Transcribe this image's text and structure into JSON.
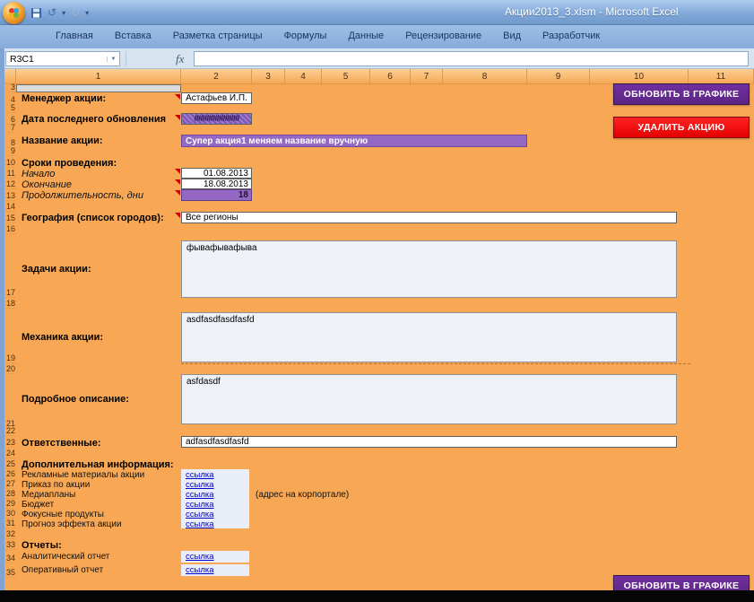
{
  "window": {
    "title": "Акции2013_3.xlsm - Microsoft Excel"
  },
  "quick_access": {
    "icons": [
      "office-button",
      "save-icon",
      "undo-icon",
      "redo-icon",
      "customize-icon"
    ]
  },
  "ribbon": {
    "tabs": [
      "Главная",
      "Вставка",
      "Разметка страницы",
      "Формулы",
      "Данные",
      "Рецензирование",
      "Вид",
      "Разработчик"
    ]
  },
  "formula_bar": {
    "name_box": "R3C1",
    "fx_label": "fx",
    "formula": ""
  },
  "grid": {
    "columns": [
      "1",
      "2",
      "3",
      "4",
      "5",
      "6",
      "7",
      "8",
      "9",
      "10",
      "11"
    ],
    "rows": [
      "3",
      "4",
      "5",
      "6",
      "7",
      "8",
      "9",
      "10",
      "11",
      "12",
      "13",
      "14",
      "15",
      "16",
      "17",
      "18",
      "19",
      "20",
      "21",
      "22",
      "23",
      "24",
      "25",
      "26",
      "27",
      "28",
      "29",
      "30",
      "31",
      "32",
      "33",
      "34",
      "35"
    ]
  },
  "form": {
    "manager_label": "Менеджер акции:",
    "manager_value": "Астафьев И.П.",
    "updated_label": "Дата последнего обновления",
    "updated_value": "###########",
    "name_label": "Название акции:",
    "name_value": "Супер акция1 меняем название вручную",
    "dates_header": "Сроки проведения:",
    "start_label": "Начало",
    "start_value": "01.08.2013",
    "end_label": "Окончание",
    "end_value": "18.08.2013",
    "duration_label": "Продолжительность, дни",
    "duration_value": "18",
    "geography_label": "География (список городов):",
    "geography_value": "Все регионы",
    "tasks_label": "Задачи акции:",
    "tasks_value": "фывафывафыва",
    "mechanics_label": "Механика акции:",
    "mechanics_value": "asdfasdfasdfasfd",
    "description_label": "Подробное описание:",
    "description_value": "asfdasdf",
    "responsible_label": "Ответственные:",
    "responsible_value": "adfasdfasdfasfd",
    "additional_header": "Дополнительная информация:",
    "extra_links": [
      {
        "label": "Рекламные материалы акции",
        "link": "ссылка",
        "note": ""
      },
      {
        "label": "Приказ по акции",
        "link": "ссылка",
        "note": ""
      },
      {
        "label": "Медиапланы",
        "link": "ссылка",
        "note": "(адрес на корпортале)"
      },
      {
        "label": "Бюджет",
        "link": "ссылка",
        "note": ""
      },
      {
        "label": "Фокусные продукты",
        "link": "ссылка",
        "note": ""
      },
      {
        "label": "Прогноз эффекта акции",
        "link": "ссылка",
        "note": ""
      }
    ],
    "reports_header": "Отчеты:",
    "report_links": [
      {
        "label": "Аналитический отчет",
        "link": "ссылка"
      },
      {
        "label": "Оперативный отчет",
        "link": "ссылка"
      }
    ]
  },
  "buttons": {
    "update_top": "ОБНОВИТЬ В ГРАФИКЕ",
    "delete": "УДАЛИТЬ АКЦИЮ",
    "update_bottom": "ОБНОВИТЬ В ГРАФИКЕ"
  },
  "colors": {
    "accent_purple": "#7030A0",
    "banner_purple": "#9468C4",
    "delete_red": "#FF0000",
    "sheet_orange": "#F8A854",
    "link_blue": "#0000CC",
    "titlebar_blue": "#7FA5D2"
  }
}
